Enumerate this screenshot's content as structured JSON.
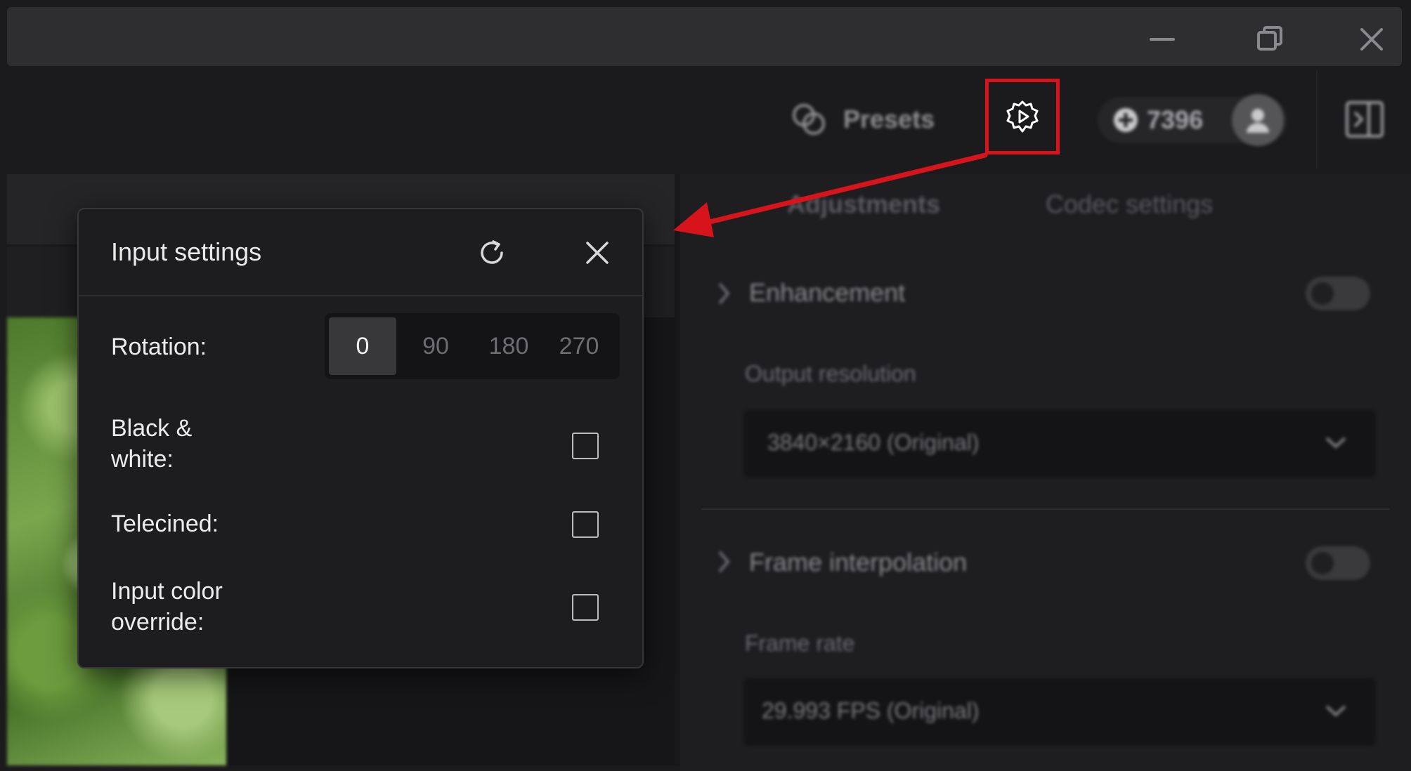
{
  "titlebar": {
    "icons": [
      "minimize-icon",
      "restore-icon",
      "close-icon"
    ]
  },
  "toolbar": {
    "presets_label": "Presets",
    "credits": "7396",
    "icons": [
      "presets-icon",
      "gear-play-icon",
      "credit-coin-icon",
      "user-icon",
      "panel-toggle-icon"
    ]
  },
  "right_panel": {
    "tabs": [
      {
        "label": "Adjustments",
        "active": true
      },
      {
        "label": "Codec settings",
        "active": false
      }
    ],
    "enhancement": {
      "title": "Enhancement",
      "enabled": false,
      "output_resolution_label": "Output resolution",
      "output_resolution_value": "3840×2160 (Original)"
    },
    "frame_interpolation": {
      "title": "Frame interpolation",
      "enabled": false,
      "frame_rate_label": "Frame rate",
      "frame_rate_value": "29.993 FPS (Original)"
    }
  },
  "dialog": {
    "title": "Input settings",
    "rotation": {
      "label": "Rotation:",
      "options": [
        "0",
        "90",
        "180",
        "270"
      ],
      "selected": "0"
    },
    "black_white": {
      "label_line1": "Black &",
      "label_line2": "white:",
      "checked": false
    },
    "telecined": {
      "label": "Telecined:",
      "checked": false
    },
    "color_override": {
      "label_line1": "Input color",
      "label_line2": "override:",
      "checked": false
    }
  },
  "colors": {
    "highlight_red": "#d7141b",
    "background": "#1b1b1d",
    "dialog_bg": "#1d1d20"
  }
}
